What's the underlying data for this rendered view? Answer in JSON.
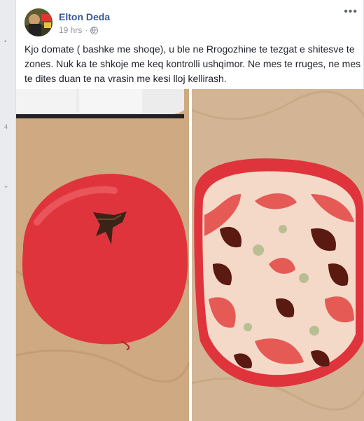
{
  "post": {
    "author": "Elton Deda",
    "time": "19 hrs",
    "more_label": "•••",
    "text": "Kjo domate ( bashke me shoqe), u ble ne Rrogozhine te tezgat e shitesve te zones. Nuk ka te shkoje me keq kontrolli ushqimor. Ne mes te rruges, ne mes te dites duan te na vrasin me kesi lloj kellirash."
  },
  "left_rail": [
    "•",
    "4",
    "+"
  ],
  "icons": {
    "privacy": "globe-icon",
    "menu": "more-options-icon"
  },
  "colors": {
    "author": "#365899",
    "tomato": "#e0343d",
    "flesh": "#f4d9c8"
  }
}
